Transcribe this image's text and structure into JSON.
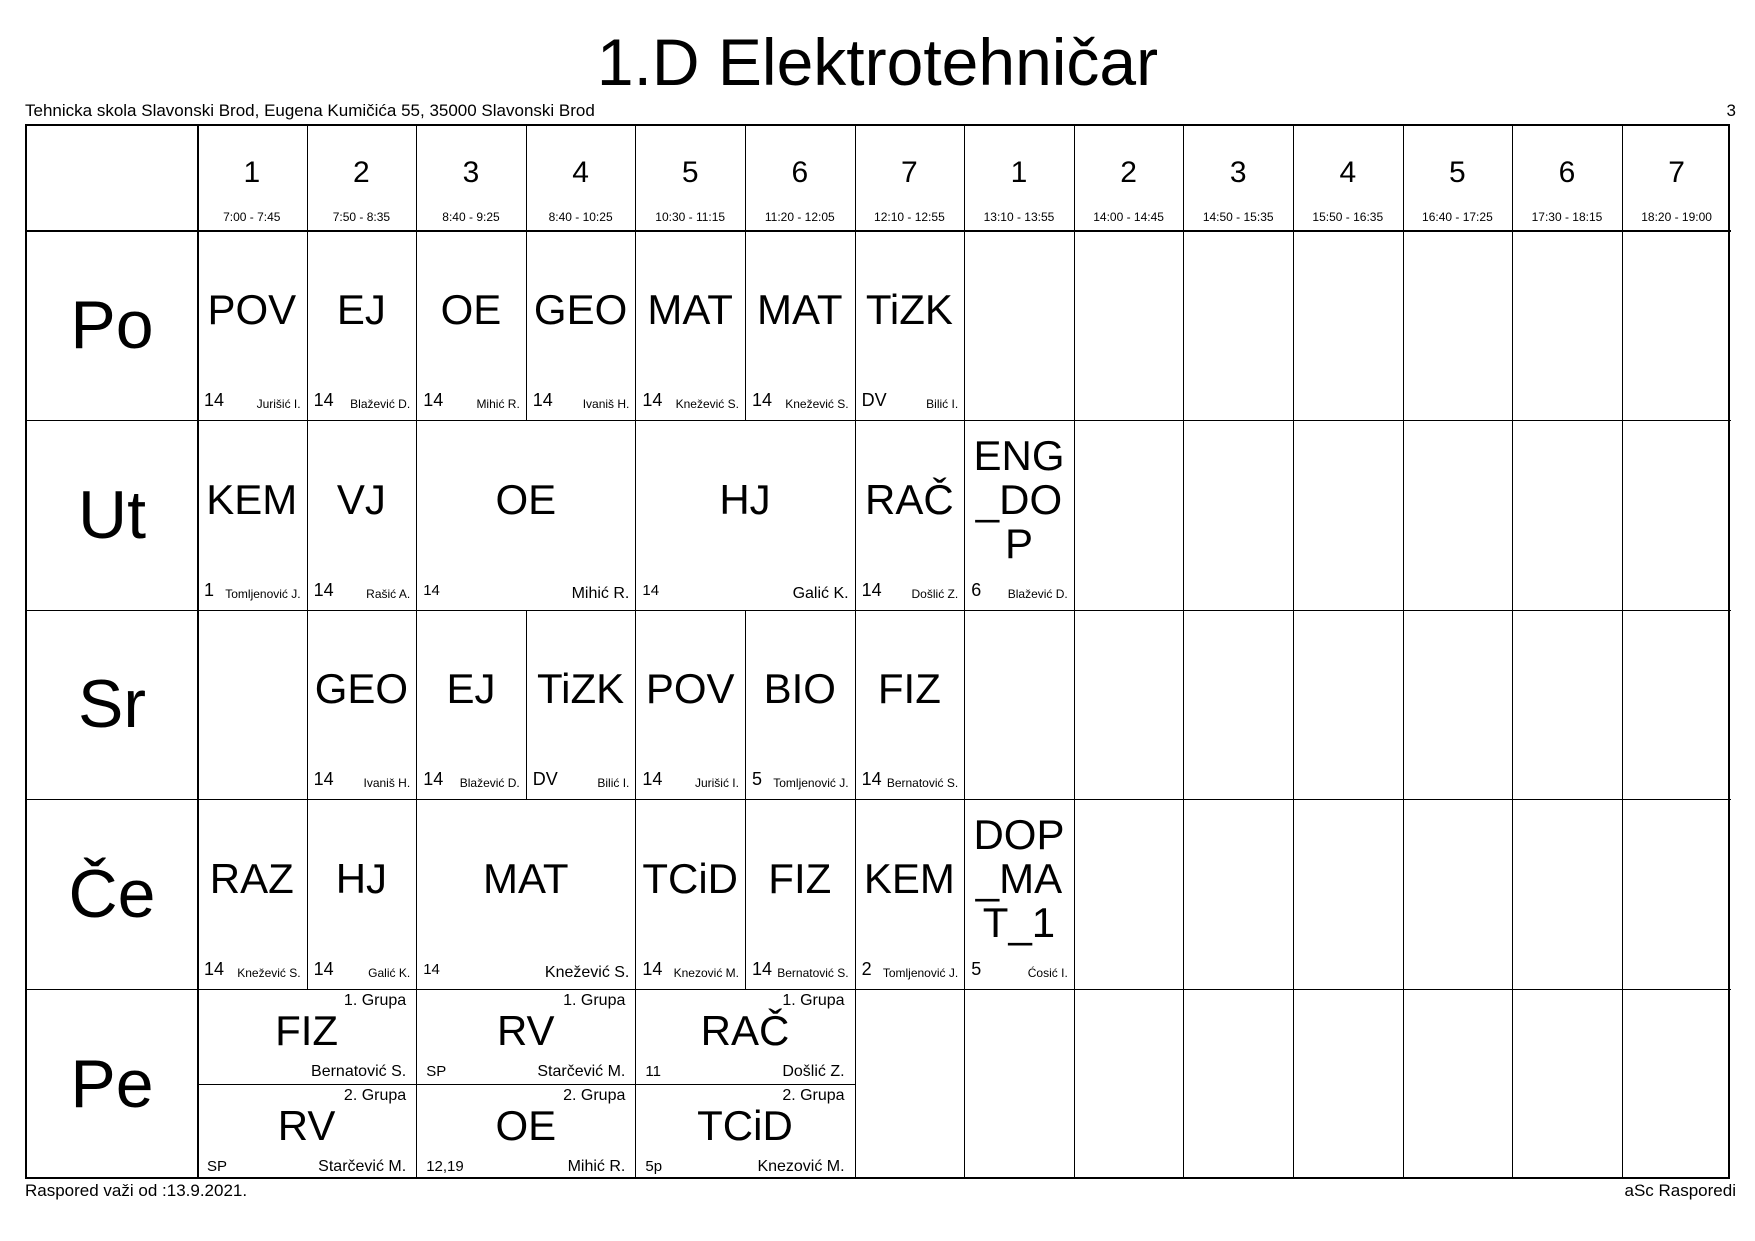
{
  "title": "1.D Elektrotehničar",
  "school": "Tehnicka skola Slavonski Brod, Eugena Kumičića 55, 35000 Slavonski Brod",
  "page_number": "3",
  "footer_left": "Raspored važi od :13.9.2021.",
  "footer_right": "aSc Rasporedi",
  "periods": [
    {
      "num": "1",
      "time": "7:00 - 7:45"
    },
    {
      "num": "2",
      "time": "7:50 - 8:35"
    },
    {
      "num": "3",
      "time": "8:40 - 9:25"
    },
    {
      "num": "4",
      "time": "8:40 - 10:25"
    },
    {
      "num": "5",
      "time": "10:30 - 11:15"
    },
    {
      "num": "6",
      "time": "11:20 - 12:05"
    },
    {
      "num": "7",
      "time": "12:10 - 12:55"
    },
    {
      "num": "1",
      "time": "13:10 - 13:55"
    },
    {
      "num": "2",
      "time": "14:00 - 14:45"
    },
    {
      "num": "3",
      "time": "14:50 - 15:35"
    },
    {
      "num": "4",
      "time": "15:50 - 16:35"
    },
    {
      "num": "5",
      "time": "16:40 - 17:25"
    },
    {
      "num": "6",
      "time": "17:30 - 18:15"
    },
    {
      "num": "7",
      "time": "18:20 - 19:00"
    }
  ],
  "days": [
    "Po",
    "Ut",
    "Sr",
    "Če",
    "Pe"
  ],
  "lessons": [
    {
      "day": 0,
      "col": 0,
      "span": 1,
      "subject": "POV",
      "room": "14",
      "teacher": "Jurišić I."
    },
    {
      "day": 0,
      "col": 1,
      "span": 1,
      "subject": "EJ",
      "room": "14",
      "teacher": "Blažević D."
    },
    {
      "day": 0,
      "col": 2,
      "span": 1,
      "subject": "OE",
      "room": "14",
      "teacher": "Mihić R."
    },
    {
      "day": 0,
      "col": 3,
      "span": 1,
      "subject": "GEO",
      "room": "14",
      "teacher": "Ivaniš H."
    },
    {
      "day": 0,
      "col": 4,
      "span": 1,
      "subject": "MAT",
      "room": "14",
      "teacher": "Knežević S."
    },
    {
      "day": 0,
      "col": 5,
      "span": 1,
      "subject": "MAT",
      "room": "14",
      "teacher": "Knežević S."
    },
    {
      "day": 0,
      "col": 6,
      "span": 1,
      "subject": "TiZK",
      "room": "DV",
      "teacher": "Bilić I."
    },
    {
      "day": 1,
      "col": 0,
      "span": 1,
      "subject": "KEM",
      "room": "1",
      "teacher": "Tomljenović J."
    },
    {
      "day": 1,
      "col": 1,
      "span": 1,
      "subject": "VJ",
      "room": "14",
      "teacher": "Rašić A."
    },
    {
      "day": 1,
      "col": 2,
      "span": 2,
      "subject": "OE",
      "room": "14",
      "teacher": "Mihić R."
    },
    {
      "day": 1,
      "col": 4,
      "span": 2,
      "subject": "HJ",
      "room": "14",
      "teacher": "Galić K."
    },
    {
      "day": 1,
      "col": 6,
      "span": 1,
      "subject": "RAČ",
      "room": "14",
      "teacher": "Došlić Z."
    },
    {
      "day": 1,
      "col": 7,
      "span": 1,
      "subject": "ENG_DOP",
      "room": "6",
      "teacher": "Blažević D."
    },
    {
      "day": 2,
      "col": 1,
      "span": 1,
      "subject": "GEO",
      "room": "14",
      "teacher": "Ivaniš H."
    },
    {
      "day": 2,
      "col": 2,
      "span": 1,
      "subject": "EJ",
      "room": "14",
      "teacher": "Blažević D."
    },
    {
      "day": 2,
      "col": 3,
      "span": 1,
      "subject": "TiZK",
      "room": "DV",
      "teacher": "Bilić I."
    },
    {
      "day": 2,
      "col": 4,
      "span": 1,
      "subject": "POV",
      "room": "14",
      "teacher": "Jurišić I."
    },
    {
      "day": 2,
      "col": 5,
      "span": 1,
      "subject": "BIO",
      "room": "5",
      "teacher": "Tomljenović J."
    },
    {
      "day": 2,
      "col": 6,
      "span": 1,
      "subject": "FIZ",
      "room": "14",
      "teacher": "Bernatović S."
    },
    {
      "day": 3,
      "col": 0,
      "span": 1,
      "subject": "RAZ",
      "room": "14",
      "teacher": "Knežević S."
    },
    {
      "day": 3,
      "col": 1,
      "span": 1,
      "subject": "HJ",
      "room": "14",
      "teacher": "Galić K."
    },
    {
      "day": 3,
      "col": 2,
      "span": 2,
      "subject": "MAT",
      "room": "14",
      "teacher": "Knežević S."
    },
    {
      "day": 3,
      "col": 4,
      "span": 1,
      "subject": "TCiD",
      "room": "14",
      "teacher": "Knezović M."
    },
    {
      "day": 3,
      "col": 5,
      "span": 1,
      "subject": "FIZ",
      "room": "14",
      "teacher": "Bernatović S."
    },
    {
      "day": 3,
      "col": 6,
      "span": 1,
      "subject": "KEM",
      "room": "2",
      "teacher": "Tomljenović J."
    },
    {
      "day": 3,
      "col": 7,
      "span": 1,
      "subject": "DOP_MAT_1",
      "room": "5",
      "teacher": "Ćosić I."
    }
  ],
  "group_lessons": [
    {
      "col": 0,
      "span": 2,
      "half": 0,
      "group": "1. Grupa",
      "subject": "FIZ",
      "room": "",
      "teacher": "Bernatović S."
    },
    {
      "col": 2,
      "span": 2,
      "half": 0,
      "group": "1. Grupa",
      "subject": "RV",
      "room": "SP",
      "teacher": "Starčević M."
    },
    {
      "col": 4,
      "span": 2,
      "half": 0,
      "group": "1. Grupa",
      "subject": "RAČ",
      "room": "11",
      "teacher": "Došlić Z."
    },
    {
      "col": 0,
      "span": 2,
      "half": 1,
      "group": "2. Grupa",
      "subject": "RV",
      "room": "SP",
      "teacher": "Starčević M."
    },
    {
      "col": 2,
      "span": 2,
      "half": 1,
      "group": "2. Grupa",
      "subject": "OE",
      "room": "12,19",
      "teacher": "Mihić R."
    },
    {
      "col": 4,
      "span": 2,
      "half": 1,
      "group": "2. Grupa",
      "subject": "TCiD",
      "room": "5p",
      "teacher": "Knezović M."
    }
  ]
}
